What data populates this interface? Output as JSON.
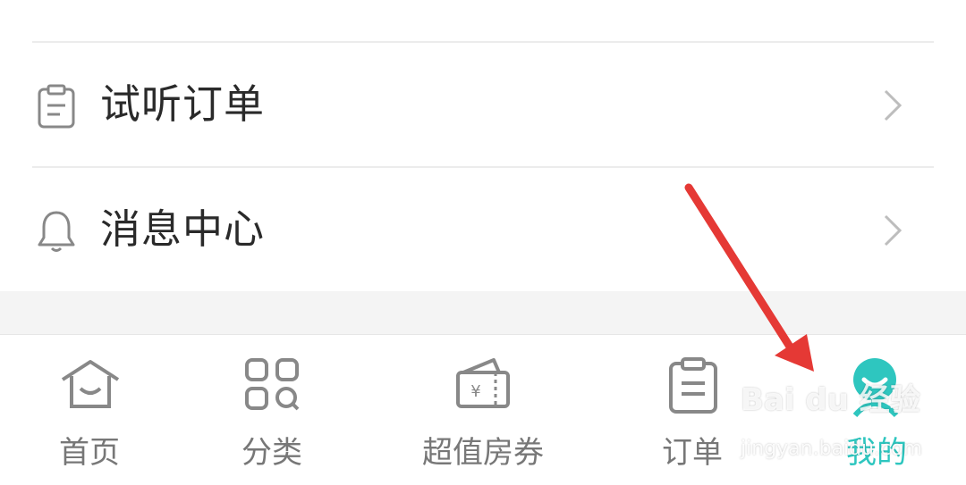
{
  "menu": {
    "items": [
      {
        "label": "试听订单",
        "icon": "clipboard-icon"
      },
      {
        "label": "消息中心",
        "icon": "bell-icon"
      }
    ]
  },
  "tabbar": {
    "tabs": [
      {
        "label": "首页",
        "icon": "home-icon",
        "active": false
      },
      {
        "label": "分类",
        "icon": "category-grid-icon",
        "active": false
      },
      {
        "label": "超值房券",
        "icon": "coupon-wallet-icon",
        "active": false
      },
      {
        "label": "订单",
        "icon": "order-clipboard-icon",
        "active": false
      },
      {
        "label": "我的",
        "icon": "profile-smile-icon",
        "active": true
      }
    ]
  },
  "annotation": {
    "arrow_color": "#e53935"
  },
  "colors": {
    "accent": "#2ec6bf",
    "inactive": "#777777"
  },
  "watermark": {
    "brand": "Bai du 经验",
    "domain": "jingyan.baidu.com"
  }
}
